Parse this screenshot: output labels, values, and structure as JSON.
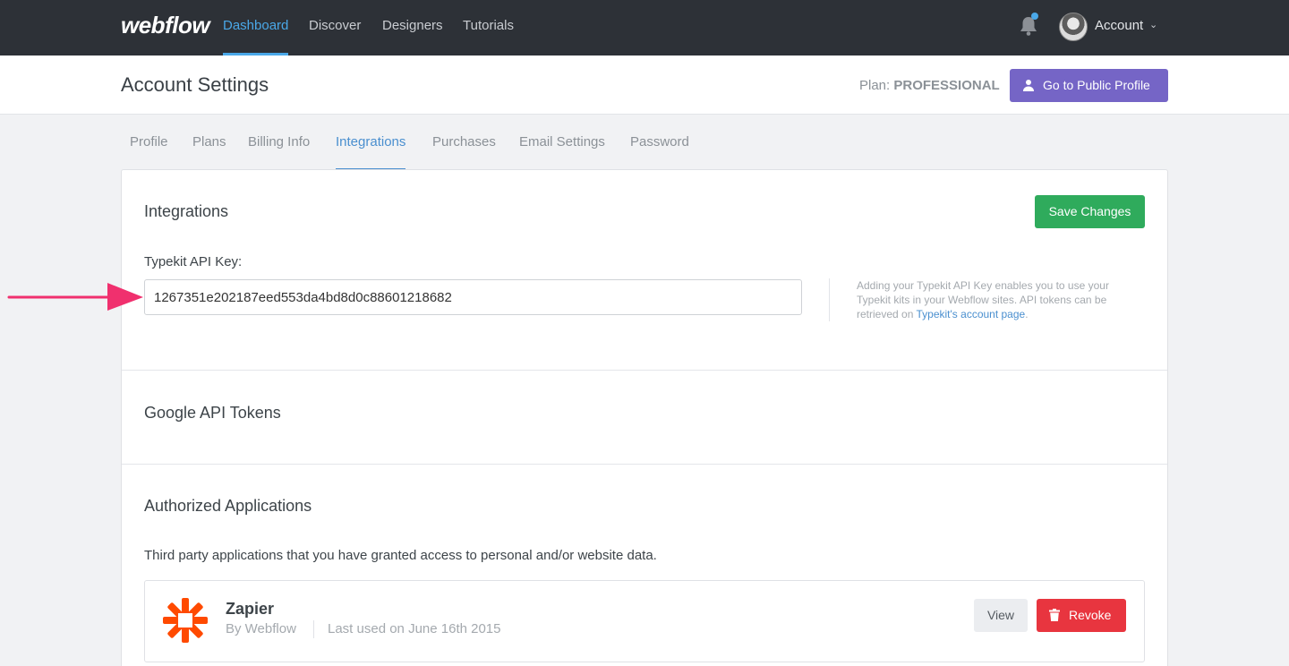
{
  "nav": {
    "logo": "webflow",
    "links": [
      "Dashboard",
      "Discover",
      "Designers",
      "Tutorials"
    ],
    "active_link": "Dashboard",
    "account_label": "Account"
  },
  "header": {
    "title": "Account Settings",
    "plan_label": "Plan:",
    "plan_value": "PROFESSIONAL",
    "public_profile_button": "Go to Public Profile"
  },
  "tabs": [
    "Profile",
    "Plans",
    "Billing Info",
    "Integrations",
    "Purchases",
    "Email Settings",
    "Password"
  ],
  "active_tab": "Integrations",
  "integrations": {
    "title": "Integrations",
    "save_button": "Save Changes",
    "typekit_label": "Typekit API Key:",
    "typekit_value": "1267351e202187eed553da4bd8d0c88601218682",
    "help_text": "Adding your Typekit API Key enables you to use your Typekit kits in your Webflow sites. API tokens can be retrieved on",
    "help_link": "Typekit's account page",
    "help_end": "."
  },
  "google": {
    "title": "Google API Tokens"
  },
  "authorized": {
    "title": "Authorized Applications",
    "description": "Third party applications that you have granted access to personal and/or website data.",
    "apps": [
      {
        "name": "Zapier",
        "by": "By Webflow",
        "last_used": "Last used on June 16th 2015",
        "view_button": "View",
        "revoke_button": "Revoke"
      }
    ]
  },
  "icons": {
    "bell": "bell-icon",
    "user": "user-icon",
    "trash": "trash-icon",
    "chevron": "chevron-down-icon",
    "zapier": "zapier-logo-icon"
  },
  "colors": {
    "nav_bg": "#2d3137",
    "accent_blue": "#4aa8e8",
    "profile_button": "#7565c6",
    "save_button": "#2fab5c",
    "revoke_button": "#e8353f",
    "zapier_orange": "#ff4a00",
    "annotation_arrow": "#f0306e"
  }
}
